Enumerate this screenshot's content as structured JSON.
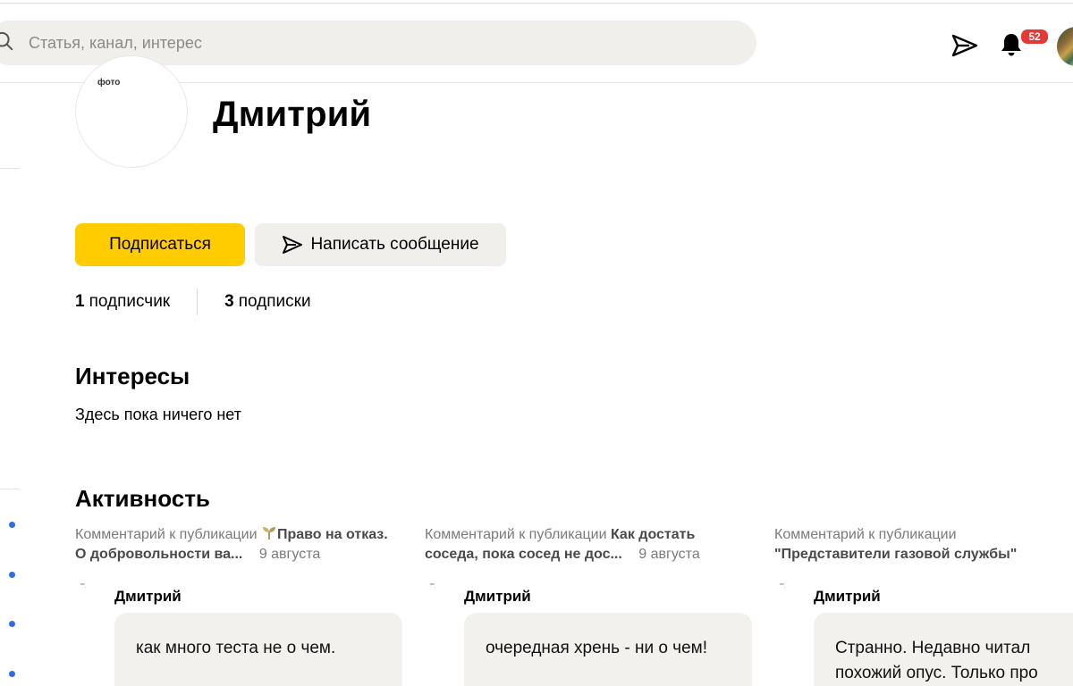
{
  "header": {
    "search_placeholder": "Статья, канал, интерес",
    "notifications_count": "52"
  },
  "profile": {
    "avatar_text": "фото",
    "name": "Дмитрий",
    "subscribe_label": "Подписаться",
    "message_label": "Написать сообщение",
    "followers_count": "1",
    "followers_label": "подписчик",
    "following_count": "3",
    "following_label": "подписки"
  },
  "interests": {
    "title": "Интересы",
    "empty_text": "Здесь пока ничего нет"
  },
  "activity": {
    "title": "Активность",
    "items": [
      {
        "prefix": "Комментарий к публикации",
        "publication": "Право на отказ. О добровольности ва...",
        "date": "9 августа",
        "author": "Дмитрий",
        "comment": "как много теста не о чем."
      },
      {
        "prefix": "Комментарий к публикации",
        "publication": "Как достать соседа, пока сосед не дос...",
        "date": "9 августа",
        "author": "Дмитрий",
        "comment": "очередная хрень - ни о чем!"
      },
      {
        "prefix": "Комментарий к публикации",
        "publication": "\"Представители газовой службы\"",
        "date": "",
        "author": "Дмитрий",
        "comment": "Странно. Недавно читал похожий опус. Только про"
      }
    ]
  },
  "colors": {
    "accent_yellow": "#ffcc00",
    "secondary_button": "#f0efec",
    "badge_red": "#e53935",
    "link_dot_blue": "#2a6fe8"
  }
}
